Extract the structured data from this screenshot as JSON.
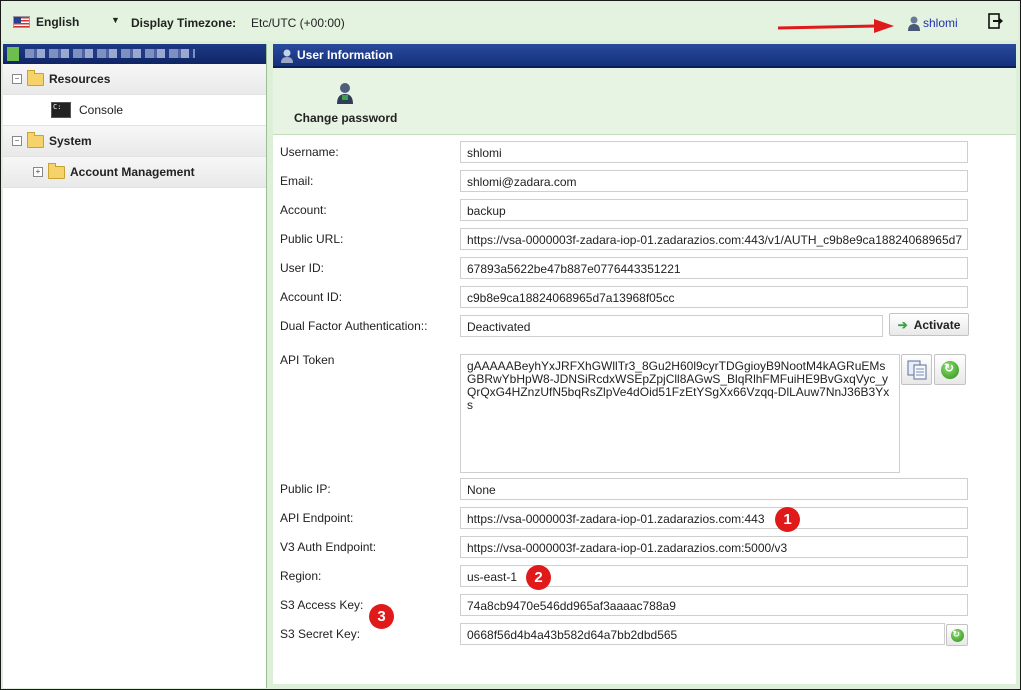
{
  "topbar": {
    "language": "English",
    "timezone_label": "Display Timezone:",
    "timezone_value": "Etc/UTC (+00:00)",
    "username": "shlomi"
  },
  "sidebar": {
    "items": [
      {
        "label": "Resources"
      },
      {
        "label": "Console"
      },
      {
        "label": "System"
      },
      {
        "label": "Account Management"
      }
    ]
  },
  "main": {
    "title": "User Information",
    "change_password": "Change password",
    "fields": {
      "username": {
        "label": "Username:",
        "value": "shlomi"
      },
      "email": {
        "label": "Email:",
        "value": "shlomi@zadara.com"
      },
      "account": {
        "label": "Account:",
        "value": "backup"
      },
      "public_url": {
        "label": "Public URL:",
        "value": "https://vsa-0000003f-zadara-iop-01.zadarazios.com:443/v1/AUTH_c9b8e9ca18824068965d7"
      },
      "user_id": {
        "label": "User ID:",
        "value": "67893a5622be47b887e0776443351221"
      },
      "account_id": {
        "label": "Account ID:",
        "value": "c9b8e9ca18824068965d7a13968f05cc"
      },
      "dual_factor": {
        "label": "Dual Factor Authentication::",
        "value": "Deactivated",
        "button": "Activate"
      },
      "api_token": {
        "label": "API Token",
        "value": "gAAAAABeyhYxJRFXhGWllTr3_8Gu2H60l9cyrTDGgioyB9NootM4kAGRuEMsGBRwYbHpW8-JDNSiRcdxWSEpZpjCll8AGwS_BlqRlhFMFuiHE9BvGxqVyc_yQrQxG4HZnzUfN5bqRsZlpVe4dOid51FzEtYSgXx66Vzqq-DlLAuw7NnJ36B3Yxs"
      },
      "public_ip": {
        "label": "Public IP:",
        "value": "None"
      },
      "api_endpoint": {
        "label": "API Endpoint:",
        "value": "https://vsa-0000003f-zadara-iop-01.zadarazios.com:443"
      },
      "v3_auth": {
        "label": "V3 Auth Endpoint:",
        "value": "https://vsa-0000003f-zadara-iop-01.zadarazios.com:5000/v3"
      },
      "region": {
        "label": "Region:",
        "value": "us-east-1"
      },
      "s3_access": {
        "label": "S3 Access Key:",
        "value": "74a8cb9470e546dd965af3aaaac788a9"
      },
      "s3_secret": {
        "label": "S3 Secret Key:",
        "value": "0668f56d4b4a43b582d64a7bb2dbd565"
      }
    }
  },
  "annotations": {
    "badge1": "1",
    "badge2": "2",
    "badge3": "3",
    "color": "#e01a1a"
  }
}
